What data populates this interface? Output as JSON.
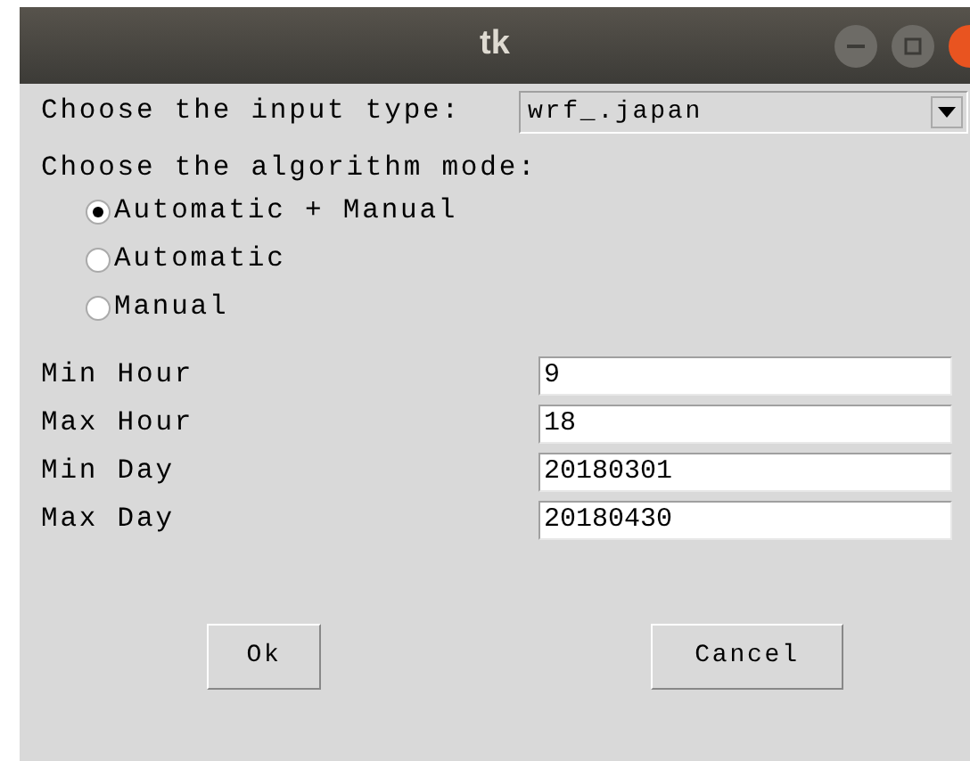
{
  "window": {
    "title": "tk"
  },
  "input_type": {
    "label": "Choose the input type:",
    "value": "wrf_.japan"
  },
  "algorithm_mode": {
    "label": "Choose the algorithm mode:",
    "options": [
      {
        "label": "Automatic + Manual",
        "selected": true
      },
      {
        "label": "Automatic",
        "selected": false
      },
      {
        "label": "Manual",
        "selected": false
      }
    ]
  },
  "fields": [
    {
      "label": "Min Hour",
      "value": "9"
    },
    {
      "label": "Max Hour",
      "value": "18"
    },
    {
      "label": "Min Day",
      "value": "20180301"
    },
    {
      "label": "Max Day",
      "value": "20180430"
    }
  ],
  "buttons": [
    "Ok",
    "Cancel"
  ]
}
